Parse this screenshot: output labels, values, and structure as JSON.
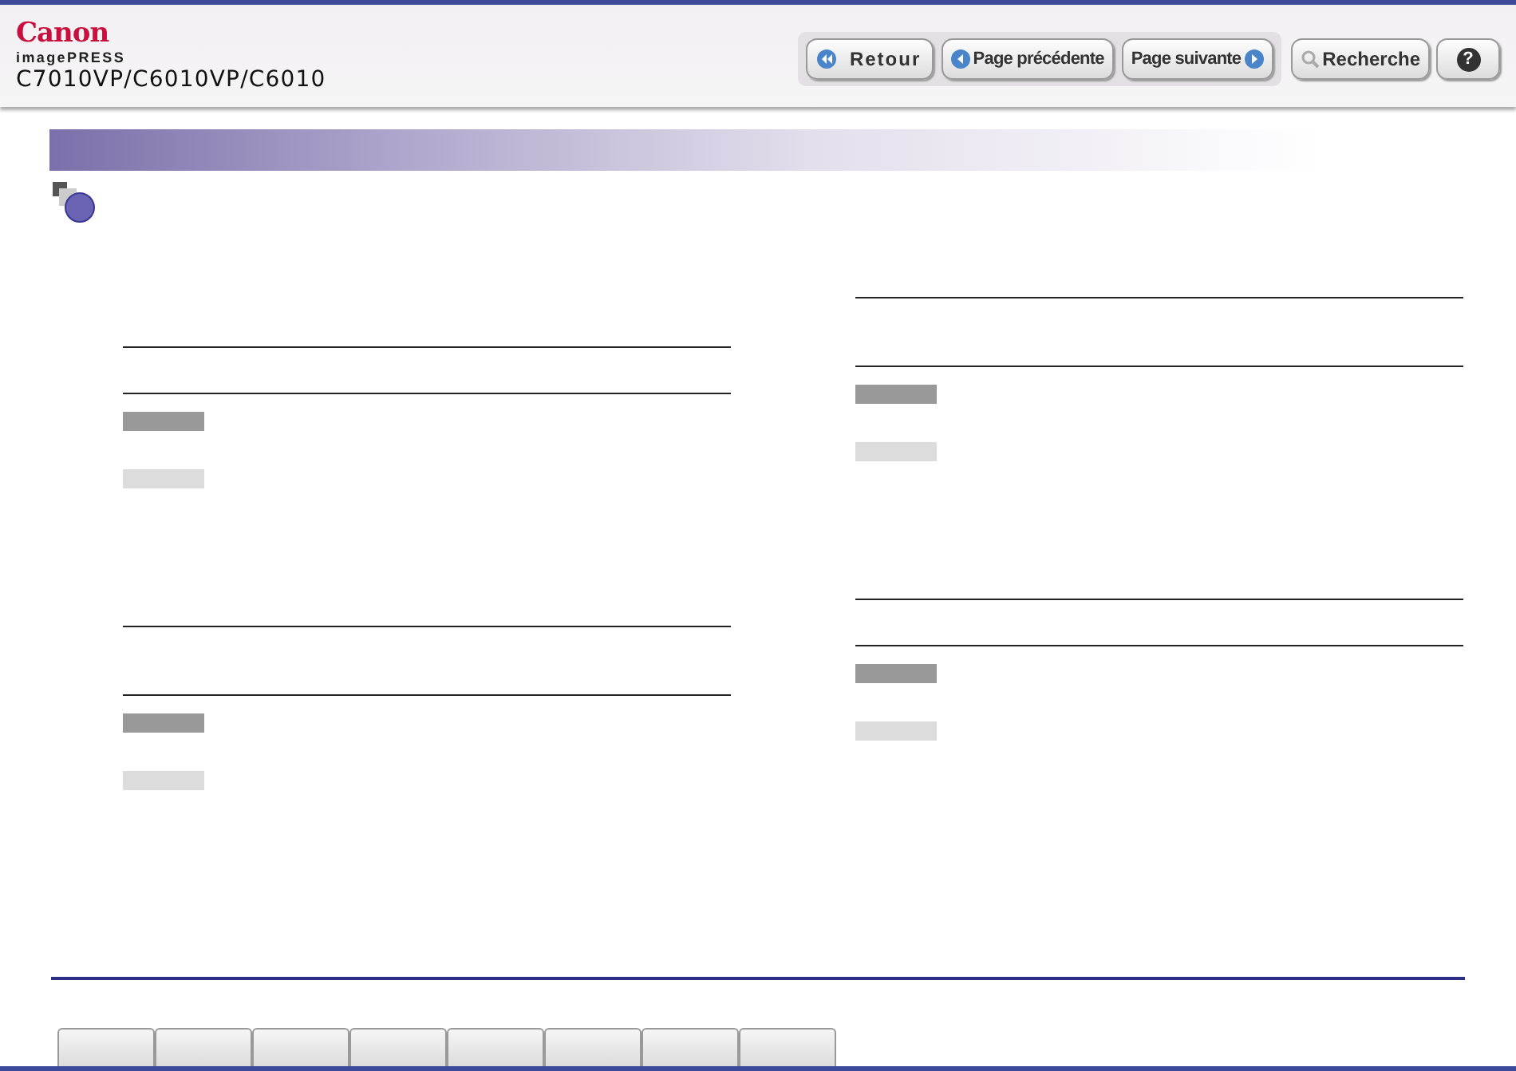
{
  "header": {
    "brand": "Canon",
    "product_line": "imagePRESS",
    "models": "C7010VP/C6010VP/C6010"
  },
  "nav_buttons": [
    {
      "kind": "back",
      "label": "Retour"
    },
    {
      "kind": "prev",
      "label": "Page précédente"
    },
    {
      "kind": "next",
      "label": "Page suivante"
    },
    {
      "kind": "search",
      "label": "Recherche"
    },
    {
      "kind": "help",
      "label": "?"
    }
  ],
  "columns": [
    {
      "blocks": [
        {
          "kind": "short",
          "entries": [
            {
              "kind": "dark"
            },
            {
              "kind": "light"
            }
          ]
        },
        {
          "kind": "tall",
          "entries": [
            {
              "kind": "dark"
            },
            {
              "kind": "light"
            }
          ]
        }
      ]
    },
    {
      "blocks": [
        {
          "kind": "tall",
          "entries": [
            {
              "kind": "dark"
            },
            {
              "kind": "light"
            }
          ]
        },
        {
          "kind": "short",
          "entries": [
            {
              "kind": "dark"
            },
            {
              "kind": "light"
            }
          ]
        }
      ]
    }
  ],
  "bottom_tabs": [
    {
      "kind": "blank"
    },
    {
      "kind": "blank"
    },
    {
      "kind": "blank"
    },
    {
      "kind": "blank"
    },
    {
      "kind": "blank"
    },
    {
      "kind": "blank"
    },
    {
      "kind": "blank"
    },
    {
      "kind": "blank"
    }
  ]
}
